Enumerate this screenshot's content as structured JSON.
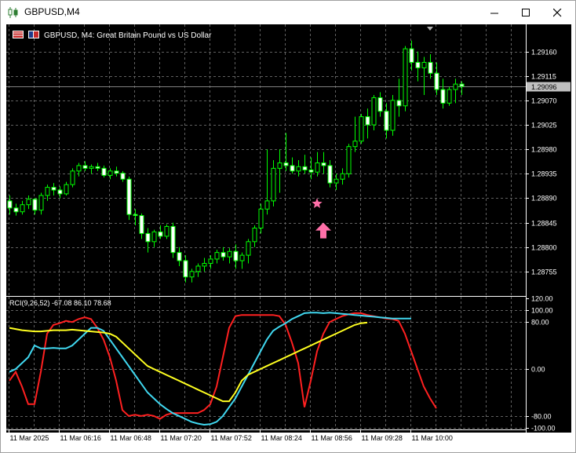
{
  "window": {
    "title": "GBPUSD,M4",
    "colors": {
      "titlebar_bg": "#ffffff",
      "chart_bg": "#000000",
      "grid": "#606060",
      "axis_text": "#ffffff",
      "bull": "#00ff00",
      "bear": "#ffffff"
    }
  },
  "symbol_label": "GBPUSD, M4:  Great Britain Pound vs US Dollar",
  "indicator_label": "RCI(9,26,52) -67.08 86.10 78.68",
  "icons": {
    "app": "candlestick-chart-icon",
    "minimize": "minimize-icon",
    "maximize": "maximize-icon",
    "close": "close-icon",
    "flag1": "flag-gb-icon",
    "flag2": "flag-us-icon",
    "scroll": "scroll-marker-icon",
    "star": "star-icon",
    "arrow": "up-arrow-icon"
  },
  "chart_data": [
    {
      "type": "candlestick",
      "title": "GBPUSD, M4:  Great Britain Pound vs US Dollar",
      "ylim": [
        1.2871,
        1.2921
      ],
      "y_ticks": [
        "1.29160",
        "1.29115",
        "1.29070",
        "1.29025",
        "1.28980",
        "1.28935",
        "1.28890",
        "1.28845",
        "1.28800",
        "1.28755"
      ],
      "current_price": "1.29096",
      "x_ticks": [
        "11 Mar 2025",
        "11 Mar 06:16",
        "11 Mar 06:48",
        "11 Mar 07:20",
        "11 Mar 07:52",
        "11 Mar 08:24",
        "11 Mar 08:56",
        "11 Mar 09:28",
        "11 Mar 10:00"
      ],
      "candles": [
        [
          1.28885,
          1.28895,
          1.2886,
          1.28872
        ],
        [
          1.28872,
          1.2888,
          1.28858,
          1.28865
        ],
        [
          1.28865,
          1.28885,
          1.2886,
          1.28878
        ],
        [
          1.28878,
          1.28895,
          1.2887,
          1.28888
        ],
        [
          1.28888,
          1.2889,
          1.2886,
          1.28868
        ],
        [
          1.28868,
          1.289,
          1.2886,
          1.28895
        ],
        [
          1.28895,
          1.28915,
          1.28885,
          1.2891
        ],
        [
          1.2891,
          1.28918,
          1.28895,
          1.28905
        ],
        [
          1.28905,
          1.28912,
          1.2889,
          1.28898
        ],
        [
          1.28898,
          1.2892,
          1.28895,
          1.28915
        ],
        [
          1.28915,
          1.28945,
          1.2891,
          1.2894
        ],
        [
          1.2894,
          1.28955,
          1.2893,
          1.2895
        ],
        [
          1.2895,
          1.28958,
          1.2894,
          1.28945
        ],
        [
          1.28945,
          1.28952,
          1.28935,
          1.28948
        ],
        [
          1.28948,
          1.28955,
          1.2894,
          1.28945
        ],
        [
          1.28945,
          1.2895,
          1.28928,
          1.28932
        ],
        [
          1.28932,
          1.28945,
          1.28925,
          1.2894
        ],
        [
          1.2894,
          1.28948,
          1.2893,
          1.28936
        ],
        [
          1.28936,
          1.2894,
          1.2892,
          1.28925
        ],
        [
          1.28925,
          1.2893,
          1.2885,
          1.2886
        ],
        [
          1.2886,
          1.2887,
          1.2884,
          1.28858
        ],
        [
          1.28858,
          1.28862,
          1.28815,
          1.28825
        ],
        [
          1.28825,
          1.28835,
          1.2879,
          1.2881
        ],
        [
          1.2881,
          1.28832,
          1.288,
          1.28828
        ],
        [
          1.28828,
          1.2884,
          1.28815,
          1.2882
        ],
        [
          1.2882,
          1.28842,
          1.28815,
          1.28838
        ],
        [
          1.28838,
          1.28845,
          1.2878,
          1.2879
        ],
        [
          1.2879,
          1.288,
          1.28765,
          1.28775
        ],
        [
          1.28775,
          1.28785,
          1.28735,
          1.28745
        ],
        [
          1.28745,
          1.2876,
          1.28735,
          1.28755
        ],
        [
          1.28755,
          1.2877,
          1.28745,
          1.28765
        ],
        [
          1.28765,
          1.2878,
          1.28755,
          1.2877
        ],
        [
          1.2877,
          1.28785,
          1.2876,
          1.28778
        ],
        [
          1.28778,
          1.28795,
          1.2877,
          1.2879
        ],
        [
          1.2879,
          1.288,
          1.28775,
          1.28782
        ],
        [
          1.28782,
          1.28798,
          1.2877,
          1.28792
        ],
        [
          1.28792,
          1.28805,
          1.2876,
          1.28775
        ],
        [
          1.28775,
          1.2879,
          1.2876,
          1.28785
        ],
        [
          1.28785,
          1.28815,
          1.2877,
          1.2881
        ],
        [
          1.2881,
          1.2884,
          1.288,
          1.28835
        ],
        [
          1.28835,
          1.2888,
          1.28825,
          1.2887
        ],
        [
          1.2887,
          1.2898,
          1.2886,
          1.28885
        ],
        [
          1.28885,
          1.2896,
          1.28875,
          1.28945
        ],
        [
          1.28945,
          1.2898,
          1.289,
          1.28955
        ],
        [
          1.28955,
          1.2901,
          1.2894,
          1.2895
        ],
        [
          1.2895,
          1.28965,
          1.28935,
          1.2894
        ],
        [
          1.2894,
          1.2896,
          1.2893,
          1.28948
        ],
        [
          1.28948,
          1.2897,
          1.28935,
          1.28942
        ],
        [
          1.28942,
          1.28965,
          1.28925,
          1.28938
        ],
        [
          1.28938,
          1.28975,
          1.2893,
          1.28955
        ],
        [
          1.28955,
          1.28975,
          1.28935,
          1.2895
        ],
        [
          1.2895,
          1.2896,
          1.2891,
          1.28918
        ],
        [
          1.28918,
          1.28935,
          1.28905,
          1.28925
        ],
        [
          1.28925,
          1.28945,
          1.28915,
          1.28935
        ],
        [
          1.28935,
          1.2899,
          1.28928,
          1.28985
        ],
        [
          1.28985,
          1.2904,
          1.28975,
          1.28995
        ],
        [
          1.28995,
          1.29045,
          1.2899,
          1.2904
        ],
        [
          1.2904,
          1.29055,
          1.29,
          1.29025
        ],
        [
          1.29025,
          1.2908,
          1.29015,
          1.29075
        ],
        [
          1.29075,
          1.29085,
          1.2904,
          1.2905
        ],
        [
          1.2905,
          1.29065,
          1.29,
          1.29015
        ],
        [
          1.29015,
          1.2908,
          1.29005,
          1.2907
        ],
        [
          1.2907,
          1.2911,
          1.2904,
          1.2906
        ],
        [
          1.2906,
          1.2917,
          1.2905,
          1.29165
        ],
        [
          1.29165,
          1.2918,
          1.29125,
          1.2914
        ],
        [
          1.2914,
          1.2916,
          1.29105,
          1.2913
        ],
        [
          1.2913,
          1.2915,
          1.2908,
          1.2914
        ],
        [
          1.2914,
          1.29155,
          1.2911,
          1.2912
        ],
        [
          1.2912,
          1.2914,
          1.2908,
          1.2909
        ],
        [
          1.2909,
          1.2911,
          1.29055,
          1.29065
        ],
        [
          1.29065,
          1.29095,
          1.2906,
          1.2909
        ],
        [
          1.2909,
          1.2911,
          1.29065,
          1.291
        ],
        [
          1.291,
          1.29105,
          1.2908,
          1.29096
        ]
      ],
      "markers": [
        {
          "kind": "star",
          "index": 49,
          "price": 1.2888
        },
        {
          "kind": "arrow-up",
          "index": 50,
          "price": 1.28845
        }
      ]
    },
    {
      "type": "line",
      "title": "RCI(9,26,52) -67.08 86.10 78.68",
      "ylim": [
        -103,
        123
      ],
      "y_ticks": [
        "120.00",
        "100.00",
        "80.00",
        "0.00",
        "-80.00",
        "-100.00"
      ],
      "series": [
        {
          "color": "#ff2020",
          "values": [
            -20,
            -5,
            -30,
            -60,
            -60,
            -5,
            60,
            75,
            78,
            82,
            80,
            85,
            88,
            85,
            70,
            50,
            20,
            -20,
            -70,
            -80,
            -78,
            -80,
            -78,
            -80,
            -85,
            -78,
            -75,
            -75,
            -75,
            -75,
            -75,
            -70,
            -60,
            -30,
            20,
            70,
            90,
            92,
            92,
            92,
            92,
            92,
            92,
            90,
            75,
            45,
            10,
            -65,
            -20,
            30,
            60,
            80,
            85,
            90,
            93,
            95,
            95,
            92,
            90,
            88,
            86,
            85,
            82,
            60,
            30,
            0,
            -30,
            -50,
            -67
          ]
        },
        {
          "color": "#40d8f0",
          "values": [
            -5,
            0,
            10,
            20,
            40,
            35,
            35,
            36,
            35,
            35,
            40,
            50,
            60,
            70,
            70,
            65,
            50,
            35,
            20,
            5,
            -10,
            -25,
            -40,
            -50,
            -60,
            -68,
            -75,
            -80,
            -85,
            -90,
            -93,
            -95,
            -94,
            -90,
            -80,
            -65,
            -50,
            -30,
            -10,
            10,
            30,
            50,
            65,
            72,
            78,
            85,
            90,
            95,
            96,
            96,
            95,
            96,
            95,
            94,
            93,
            92,
            91,
            90,
            89,
            88,
            87,
            86,
            86,
            86,
            86
          ]
        },
        {
          "color": "#ffff20",
          "values": [
            70,
            68,
            66,
            65,
            64,
            64,
            65,
            66,
            66,
            66,
            67,
            66,
            65,
            64,
            63,
            62,
            60,
            55,
            45,
            35,
            25,
            15,
            5,
            0,
            -5,
            -10,
            -15,
            -20,
            -25,
            -30,
            -35,
            -40,
            -45,
            -50,
            -55,
            -55,
            -40,
            -20,
            -10,
            -5,
            0,
            5,
            10,
            15,
            20,
            25,
            30,
            35,
            40,
            45,
            50,
            55,
            60,
            65,
            70,
            75,
            78,
            79
          ]
        }
      ]
    }
  ]
}
